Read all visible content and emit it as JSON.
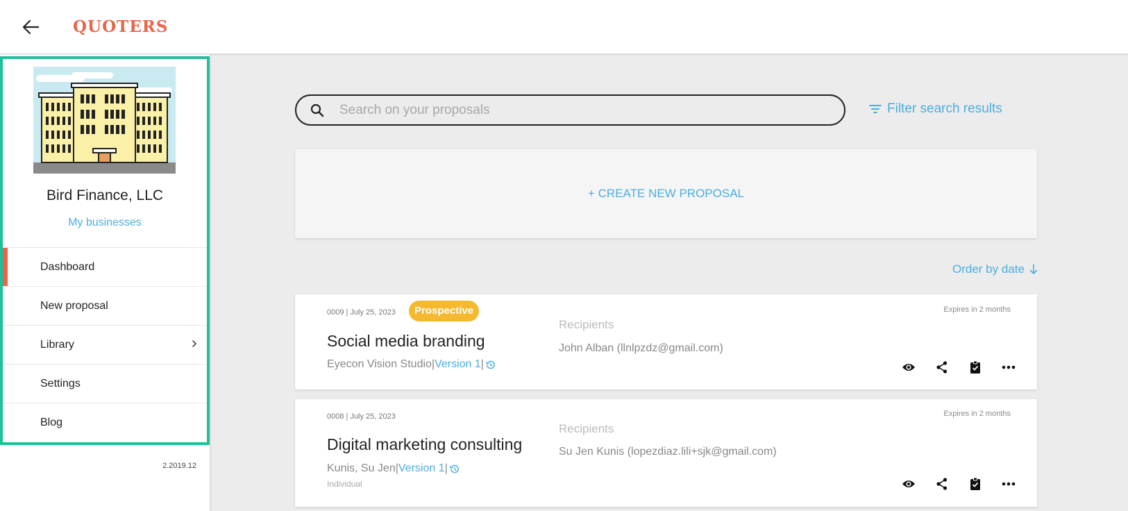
{
  "header": {
    "brand": "QUOTERS",
    "back_icon": "arrow-left-icon"
  },
  "sidebar": {
    "business_name": "Bird Finance, LLC",
    "my_businesses_label": "My businesses",
    "items": [
      {
        "label": "Dashboard",
        "active": true
      },
      {
        "label": "New proposal",
        "active": false
      },
      {
        "label": "Library",
        "active": false,
        "has_submenu": true
      },
      {
        "label": "Settings",
        "active": false
      },
      {
        "label": "Blog",
        "active": false
      }
    ],
    "version": "2.2019.12",
    "accent_color": "#e8654a",
    "frame_color": "#1fbf9a"
  },
  "search": {
    "placeholder": "Search on your proposals",
    "value": "",
    "filter_label": "Filter search results"
  },
  "create": {
    "label": "+ CREATE NEW PROPOSAL"
  },
  "order": {
    "label": "Order by date"
  },
  "proposals": [
    {
      "meta": "0009 | July 25, 2023",
      "status": "Prospective",
      "title": "Social media branding",
      "client": "Eyecon Vision Studio",
      "version": "Version 1",
      "client_type": "",
      "recipients_label": "Recipients",
      "recipients": "John Alban (llnlpzdz@gmail.com)",
      "expires": "Expires in 2 months"
    },
    {
      "meta": "0008 | July 25, 2023",
      "status": "",
      "title": "Digital marketing consulting",
      "client": "Kunis, Su Jen",
      "version": "Version 1",
      "client_type": "Individual",
      "recipients_label": "Recipients",
      "recipients": "Su Jen Kunis (lopezdiaz.lili+sjk@gmail.com)",
      "expires": "Expires in 2 months"
    }
  ],
  "colors": {
    "link": "#4aaee0",
    "badge": "#f5b82e"
  }
}
